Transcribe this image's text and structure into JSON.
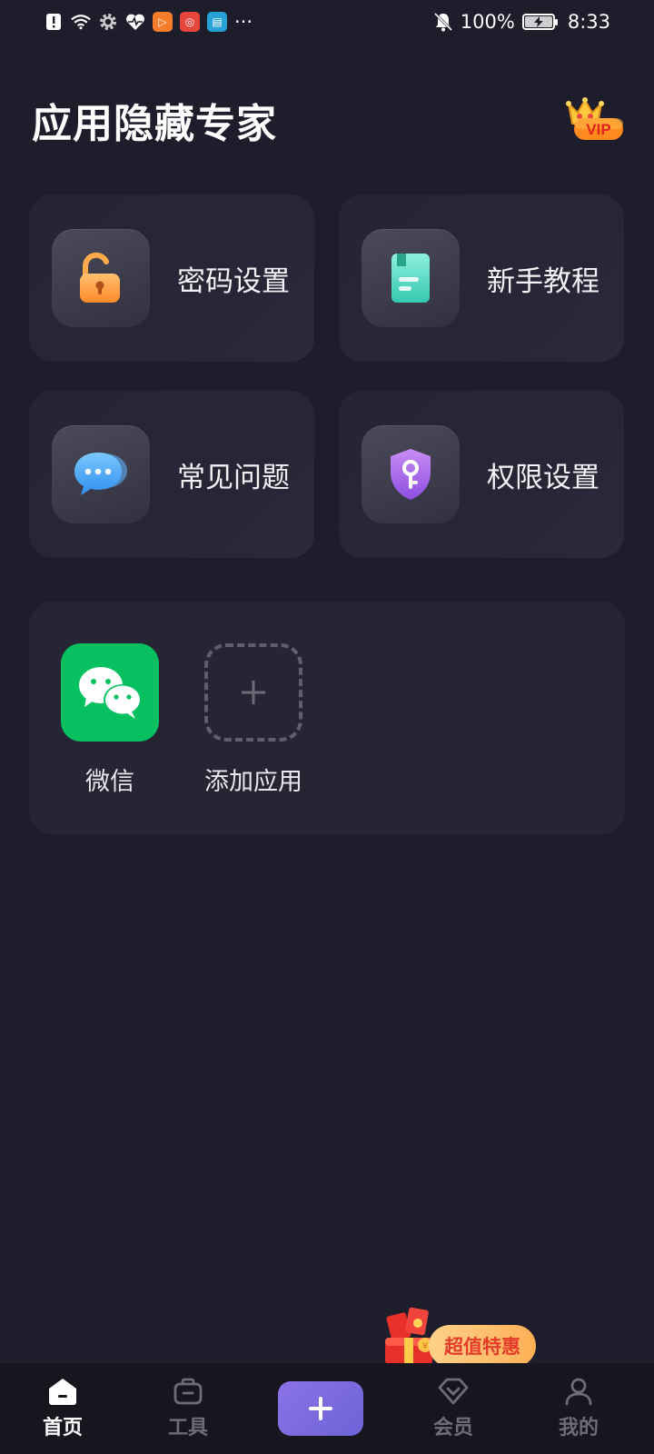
{
  "status_bar": {
    "battery_percent": "100%",
    "time": "8:33",
    "more_indicator": "···",
    "icons": [
      "alert-icon",
      "wifi-icon",
      "gear-icon",
      "health-icon",
      "video-app-icon",
      "podcast-app-icon",
      "reader-app-icon",
      "mute-bell-icon",
      "battery-charging-icon"
    ]
  },
  "header": {
    "title": "应用隐藏专家",
    "vip_label": "VIP"
  },
  "features": [
    {
      "label": "密码设置",
      "icon": "lock-icon",
      "color": "#ff9a3c"
    },
    {
      "label": "新手教程",
      "icon": "book-icon",
      "color": "#4fd6c0"
    },
    {
      "label": "常见问题",
      "icon": "chat-bubble-icon",
      "color": "#4aa8f5"
    },
    {
      "label": "权限设置",
      "icon": "shield-key-icon",
      "color": "#a866e8"
    }
  ],
  "hidden_apps": [
    {
      "label": "微信",
      "icon": "wechat-icon",
      "color": "#07c160"
    },
    {
      "label": "添加应用",
      "icon": "add-app-icon"
    }
  ],
  "promo": {
    "label": "超值特惠"
  },
  "bottom_nav": [
    {
      "label": "首页",
      "icon": "home-icon",
      "active": true
    },
    {
      "label": "工具",
      "icon": "toolbox-icon",
      "active": false
    },
    {
      "label": "",
      "icon": "plus-icon",
      "active": false
    },
    {
      "label": "会员",
      "icon": "diamond-icon",
      "active": false
    },
    {
      "label": "我的",
      "icon": "profile-icon",
      "active": false
    }
  ]
}
